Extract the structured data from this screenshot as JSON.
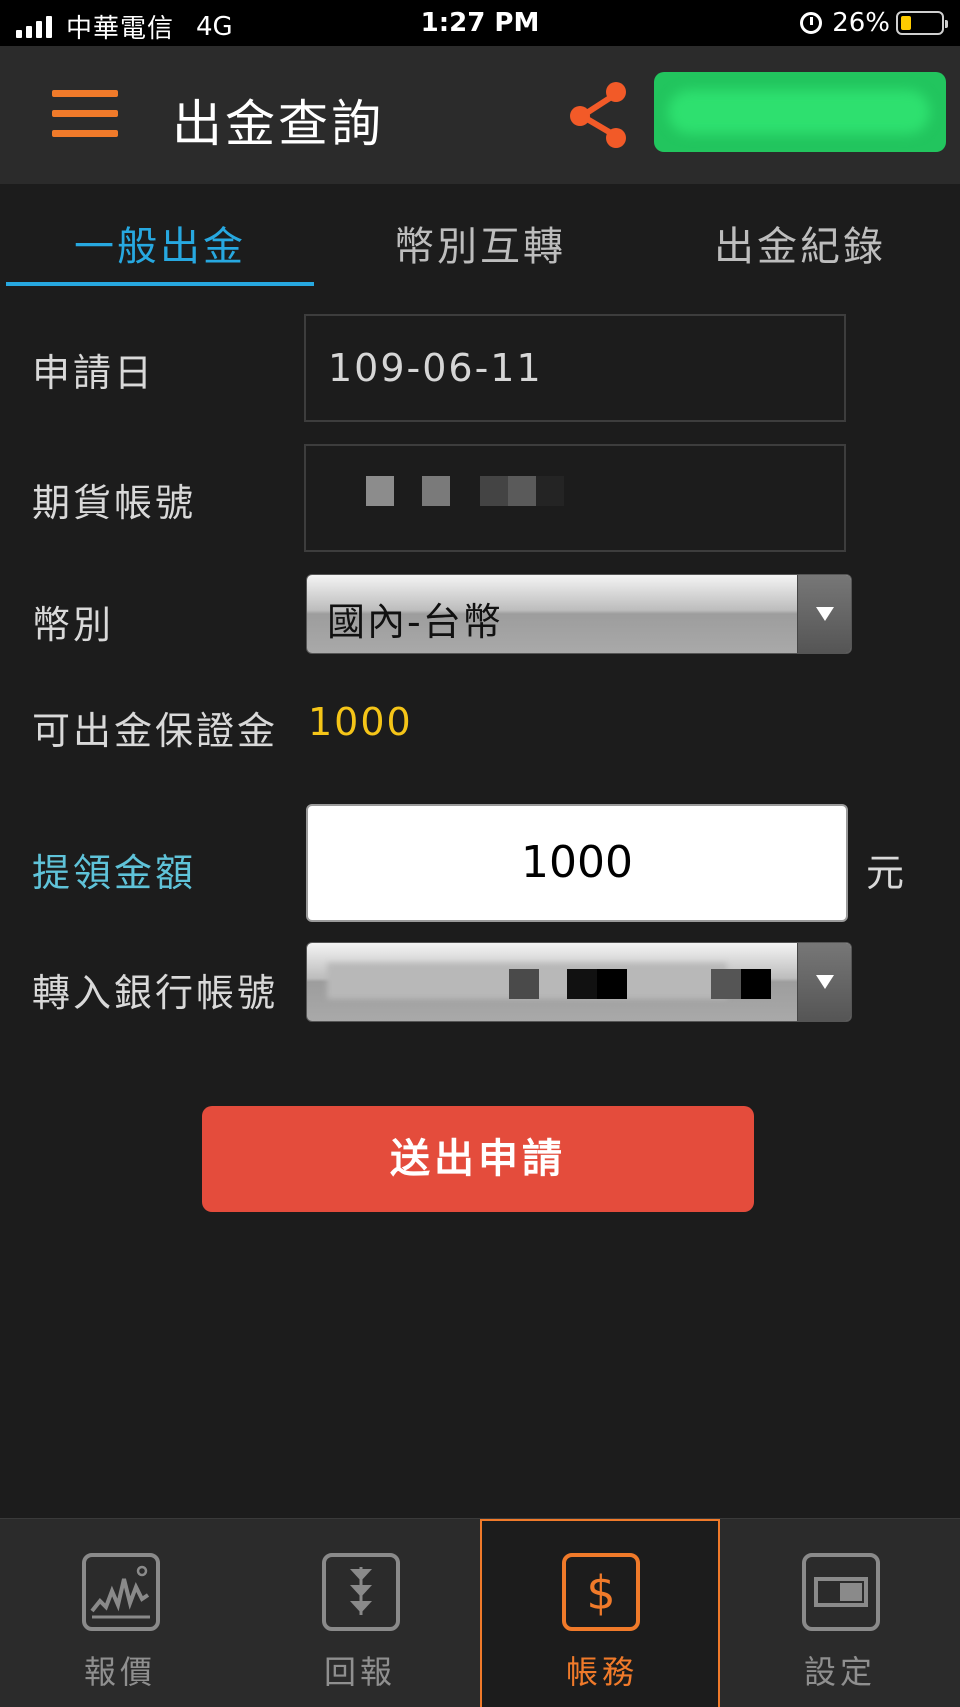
{
  "status_bar": {
    "carrier": "中華電信",
    "network": "4G",
    "time": "1:27 PM",
    "battery_percent": "26%",
    "battery_level": 0.26
  },
  "header": {
    "title": "出金查詢",
    "accent_color": "#f07a2a",
    "badge_color": "#22c55e"
  },
  "tabs": [
    {
      "label": "一般出金",
      "active": true
    },
    {
      "label": "幣別互轉",
      "active": false
    },
    {
      "label": "出金紀錄",
      "active": false
    }
  ],
  "form": {
    "apply_date_label": "申請日",
    "apply_date_value": "109-06-11",
    "futures_account_label": "期貨帳號",
    "currency_label": "幣別",
    "currency_value": "國內-台幣",
    "available_margin_label": "可出金保證金",
    "available_margin_value": "1000",
    "withdraw_amount_label": "提領金額",
    "withdraw_amount_value": "1000",
    "unit": "元",
    "bank_account_label": "轉入銀行帳號"
  },
  "submit_label": "送出申請",
  "bottom_nav": [
    {
      "label": "報價",
      "icon": "quote-chart-icon",
      "active": false
    },
    {
      "label": "回報",
      "icon": "report-arrows-icon",
      "active": false
    },
    {
      "label": "帳務",
      "icon": "dollar-icon",
      "active": true
    },
    {
      "label": "設定",
      "icon": "settings-toggle-icon",
      "active": false
    }
  ]
}
